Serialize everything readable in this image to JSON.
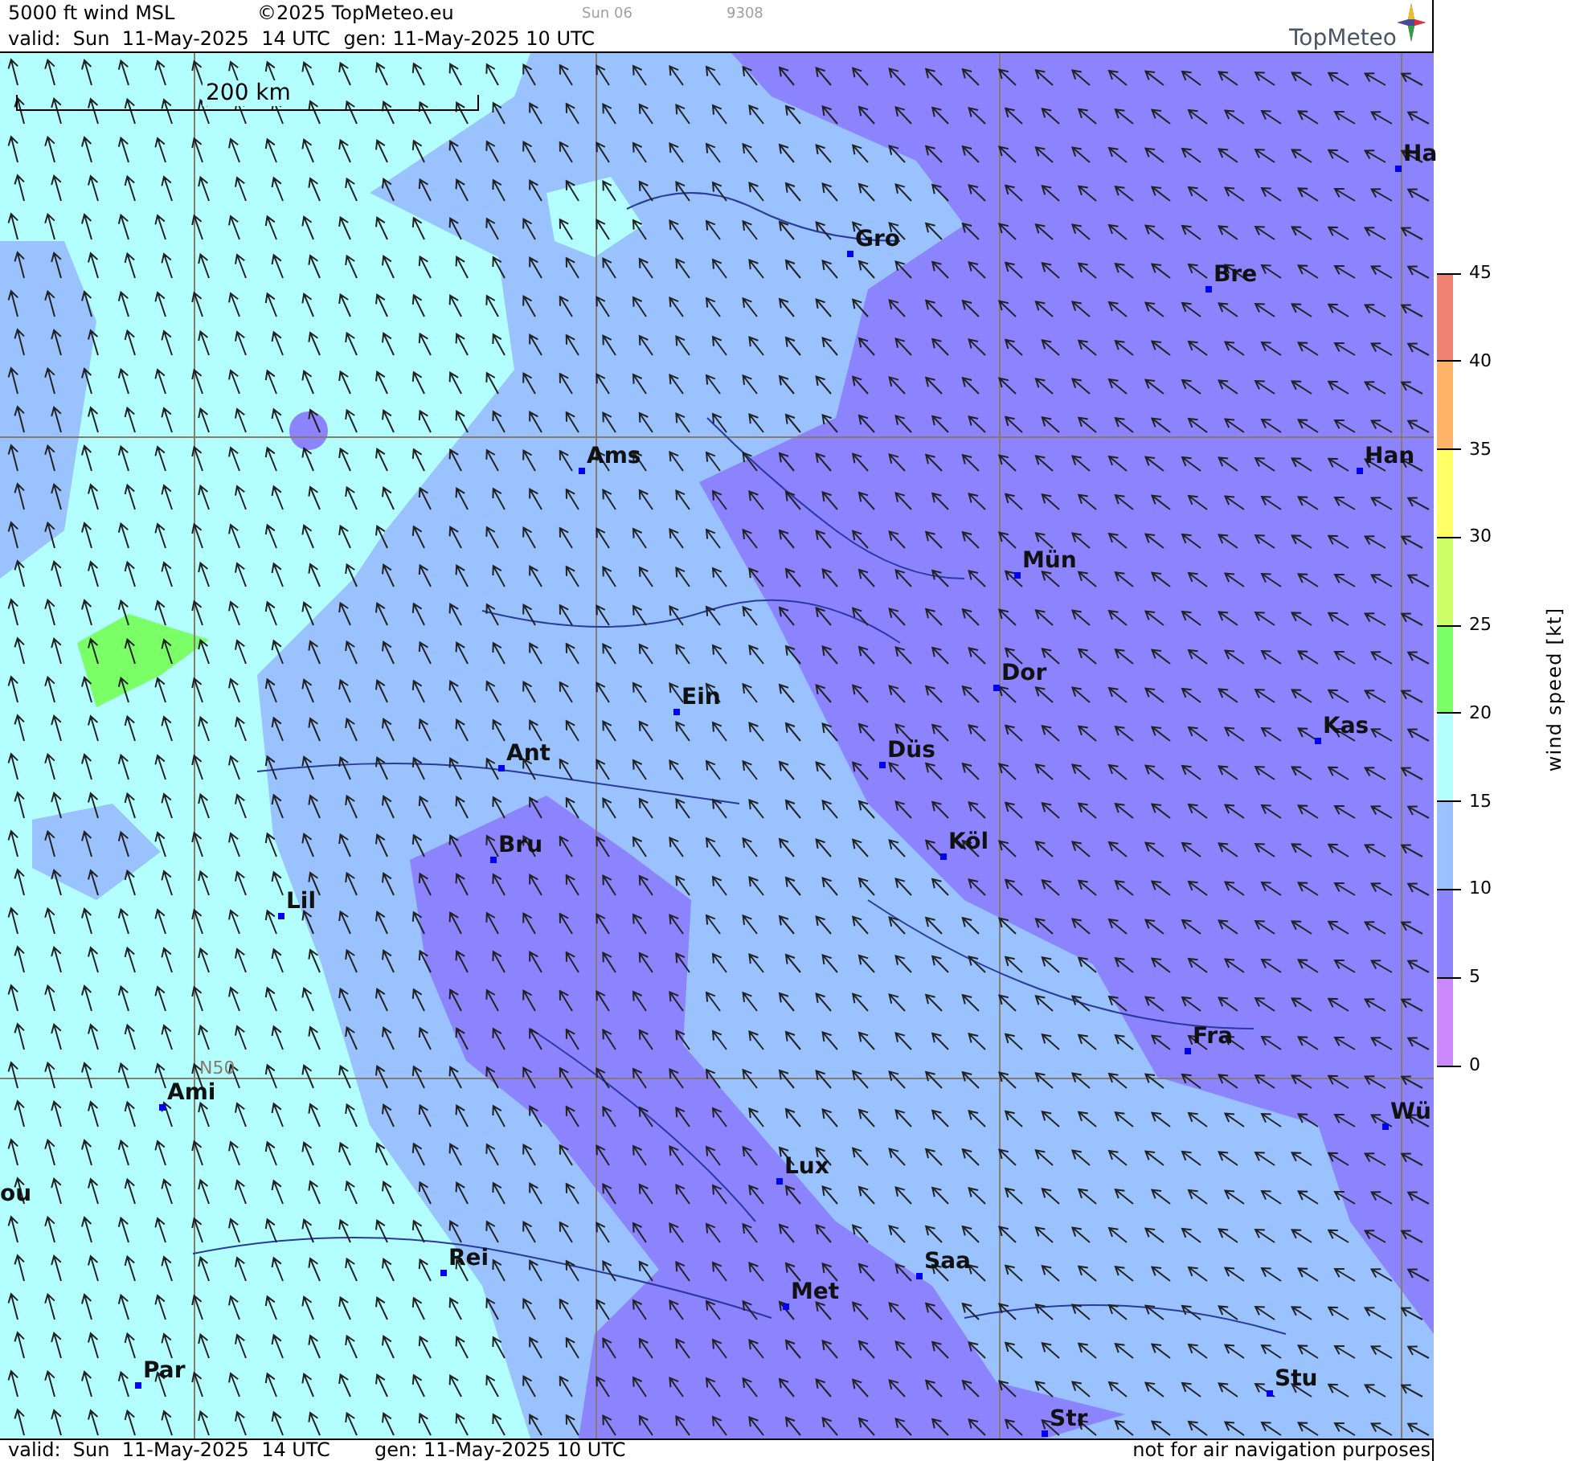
{
  "header": {
    "title": "5000 ft wind MSL",
    "copyright": "©2025 TopMeteo.eu",
    "day_code": "Sun 06",
    "code": "9308",
    "valid": "valid:  Sun  11-May-2025  14 UTC",
    "generated": "gen: 11-May-2025 10 UTC",
    "logo": "TopMeteo"
  },
  "map": {
    "scale_label": "200 km",
    "grid_label": "N50",
    "cities": [
      {
        "name": "Ha",
        "marker": true
      },
      {
        "name": "Gro",
        "marker": true
      },
      {
        "name": "Bre",
        "marker": true
      },
      {
        "name": "Ams",
        "marker": true
      },
      {
        "name": "Han",
        "marker": true
      },
      {
        "name": "Mün",
        "marker": true
      },
      {
        "name": "Dor",
        "marker": true
      },
      {
        "name": "Ein",
        "marker": true
      },
      {
        "name": "Kas",
        "marker": true
      },
      {
        "name": "Düs",
        "marker": true
      },
      {
        "name": "Ant",
        "marker": true
      },
      {
        "name": "Köl",
        "marker": true
      },
      {
        "name": "Bru",
        "marker": true
      },
      {
        "name": "Lil",
        "marker": true
      },
      {
        "name": "Fra",
        "marker": true
      },
      {
        "name": "Ami",
        "marker": true
      },
      {
        "name": "Wü",
        "marker": true
      },
      {
        "name": "Lux",
        "marker": true
      },
      {
        "name": "ou",
        "marker": false
      },
      {
        "name": "Rei",
        "marker": true
      },
      {
        "name": "Saa",
        "marker": true
      },
      {
        "name": "Met",
        "marker": true
      },
      {
        "name": "Stu",
        "marker": true
      },
      {
        "name": "Par",
        "marker": true
      },
      {
        "name": "Str",
        "marker": true
      }
    ]
  },
  "legend": {
    "title": "wind speed [kt]",
    "ticks": [
      "45",
      "40",
      "35",
      "30",
      "25",
      "20",
      "15",
      "10",
      "5",
      "0"
    ],
    "bins": [
      {
        "color": "#f08070"
      },
      {
        "color": "#ffb366"
      },
      {
        "color": "#ffff66"
      },
      {
        "color": "#ccff66"
      },
      {
        "color": "#7aff66"
      },
      {
        "color": "#b3ffff"
      },
      {
        "color": "#99c2ff"
      },
      {
        "color": "#8c83ff"
      },
      {
        "color": "#cc88ff"
      }
    ]
  },
  "footer": {
    "valid": "valid:  Sun  11-May-2025  14 UTC",
    "generated": "gen: 11-May-2025 10 UTC",
    "disclaimer": "not for air navigation purposes"
  }
}
